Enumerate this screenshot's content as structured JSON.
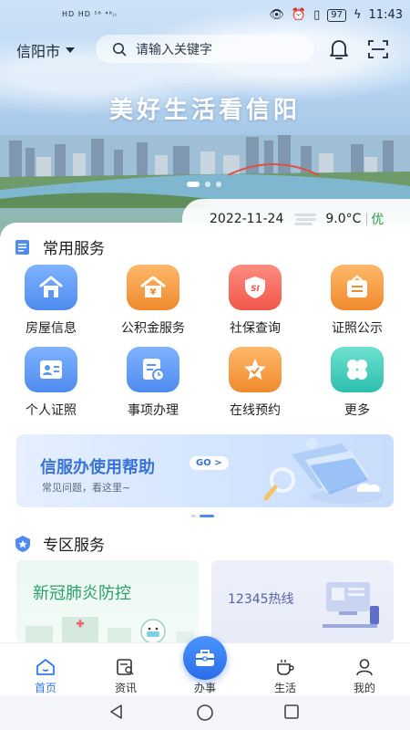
{
  "status_bar": {
    "left": "HD HD ⁵⁶ ⁴⁶ᵢₗ",
    "battery": "97",
    "time": "11:43"
  },
  "header": {
    "city": "信阳市",
    "search_placeholder": "请输入关键字"
  },
  "banner": {
    "slogan": "美好生活看信阳",
    "slide_count": 3,
    "active_slide": 1
  },
  "weather": {
    "date": "2022-11-24",
    "temperature": "9.0°C",
    "air_quality": "优"
  },
  "common_services": {
    "title": "常用服务",
    "items": [
      {
        "label": "房屋信息",
        "icon": "house-icon"
      },
      {
        "label": "公积金服务",
        "icon": "fund-house-icon"
      },
      {
        "label": "社保查询",
        "icon": "social-security-icon"
      },
      {
        "label": "证照公示",
        "icon": "certificate-board-icon"
      },
      {
        "label": "个人证照",
        "icon": "id-card-icon"
      },
      {
        "label": "事项办理",
        "icon": "task-clock-icon"
      },
      {
        "label": "在线预约",
        "icon": "star-icon"
      },
      {
        "label": "更多",
        "icon": "more-grid-icon"
      }
    ]
  },
  "help_banner": {
    "title": "信服办使用帮助",
    "go": "GO >",
    "subtitle": "常见问题，看这里~"
  },
  "special_services": {
    "title": "专区服务",
    "cards": [
      {
        "label": "新冠肺炎防控"
      },
      {
        "label": "12345热线"
      }
    ]
  },
  "tabbar": [
    {
      "label": "首页",
      "icon": "home-icon",
      "active": true
    },
    {
      "label": "资讯",
      "icon": "news-icon",
      "active": false
    },
    {
      "label": "办事",
      "icon": "briefcase-icon",
      "active": false
    },
    {
      "label": "生活",
      "icon": "coffee-cup-icon",
      "active": false
    },
    {
      "label": "我的",
      "icon": "user-icon",
      "active": false
    }
  ],
  "colors": {
    "accent": "#2f7be8",
    "good_air": "#2aa14a"
  }
}
